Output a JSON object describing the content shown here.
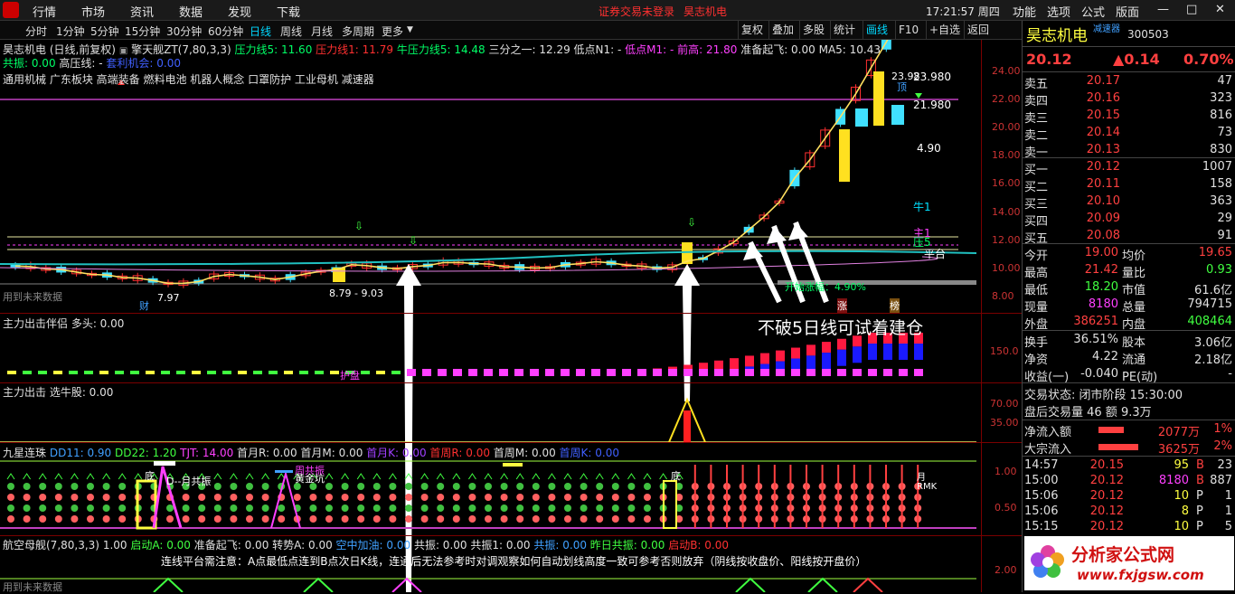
{
  "menu": [
    "行情",
    "市场",
    "资讯",
    "数据",
    "发现",
    "下载"
  ],
  "notice": [
    "证券交易未登录",
    "昊志机电"
  ],
  "clock": "17:21:57 周四",
  "right_menu": [
    "功能",
    "选项",
    "公式",
    "版面"
  ],
  "window_controls": [
    "—",
    "□",
    "✕"
  ],
  "periods": [
    "分时",
    "1分钟",
    "5分钟",
    "15分钟",
    "30分钟",
    "60分钟",
    "日线",
    "周线",
    "月线",
    "多周期",
    "更多"
  ],
  "active_period": "日线",
  "toolbar_right": [
    "复权",
    "叠加",
    "多股",
    "统计",
    "画线",
    "F10",
    "+自选",
    "返回"
  ],
  "chart": {
    "title": "昊志机电 (日线,前复权)",
    "indicator_name": "擎天舰ZT(7,80,3,3)",
    "line1": [
      {
        "t": "压力线5: 11.60",
        "c": "#00ff66"
      },
      {
        "t": "压力线1: 11.79",
        "c": "#ff3030"
      },
      {
        "t": "牛压力线5: 14.48",
        "c": "#00ff66"
      },
      {
        "t": "三分之一: 12.29",
        "c": "#e0e0e0"
      },
      {
        "t": "低点N1: -",
        "c": "#e0e0e0"
      },
      {
        "t": "低点M1: -",
        "c": "#ff40ff"
      },
      {
        "t": "前高: 21.80",
        "c": "#ff40ff"
      },
      {
        "t": "准备起飞: 0.00",
        "c": "#e0e0e0"
      },
      {
        "t": "MA5: 10.43",
        "c": "#e0e0e0"
      }
    ],
    "line2": [
      {
        "t": "共振: 0.00",
        "c": "#00ff66"
      },
      {
        "t": "高压线: -",
        "c": "#e0e0e0"
      },
      {
        "t": "套利机会: 0.00",
        "c": "#4060ff"
      }
    ],
    "sectors": "通用机械 广东板块 高端装备 燃料电池 机器人概念 口罩防护 工业母机 减速器",
    "yaxis": [
      "24.00",
      "22.00",
      "20.00",
      "18.00",
      "16.00",
      "14.00",
      "12.00",
      "10.00",
      "8.00"
    ],
    "annotations": {
      "high_label": "23.98",
      "high_right": "23.980",
      "price2": "21.980",
      "low_label": "7.97",
      "range_label": "8.79 - 9.03",
      "niu1": "牛1",
      "zhu1": "主1",
      "ya5": "压5",
      "pingtai": "平台",
      "price_mark": "4.90",
      "cai": "财",
      "zhang": "涨",
      "bang": "榜",
      "ding": "顶",
      "kaishi": "开始涨幅：4.90%",
      "future_data": "用到未来数据",
      "callout": "不破5日线可试着建仓"
    }
  },
  "panel1": {
    "title": "主力出击伴侣 多头: 0.00",
    "yaxis": [
      "150.0"
    ],
    "label": "护盘"
  },
  "panel2": {
    "title": "主力出击 选牛股: 0.00",
    "yaxis": [
      "70.00",
      "35.00"
    ]
  },
  "panel3": {
    "title": "九星连珠",
    "items": [
      {
        "t": "DD11: 0.90",
        "c": "#40a0ff"
      },
      {
        "t": "DD22: 1.20",
        "c": "#40ff40"
      },
      {
        "t": "TJT: 14.00",
        "c": "#ff40ff"
      },
      {
        "t": "首月R: 0.00",
        "c": "#e0e0e0"
      },
      {
        "t": "首月M: 0.00",
        "c": "#e0e0e0"
      },
      {
        "t": "首月K: 0.00",
        "c": "#a040ff"
      },
      {
        "t": "首周R: 0.00",
        "c": "#ff3030"
      },
      {
        "t": "首周M: 0.00",
        "c": "#e0e0e0"
      },
      {
        "t": "首周K: 0.00",
        "c": "#4060ff"
      }
    ],
    "yaxis": [
      "1.00",
      "0.50"
    ],
    "labels": {
      "di": "底",
      "month": "D--月共振",
      "gold": "黄金坑",
      "week": "周共振",
      "right_di": "底",
      "rm": "月RMK"
    }
  },
  "panel4": {
    "title": "航空母舰(7,80,3,3)",
    "items": [
      {
        "t": "1.00",
        "c": "#e0e0e0"
      },
      {
        "t": "启动A: 0.00",
        "c": "#40ff40"
      },
      {
        "t": "准备起飞: 0.00",
        "c": "#e0e0e0"
      },
      {
        "t": "转势A: 0.00",
        "c": "#e0e0e0"
      },
      {
        "t": "空中加油: 0.00",
        "c": "#40a0ff"
      },
      {
        "t": "共振: 0.00",
        "c": "#e0e0e0"
      },
      {
        "t": "共振1: 0.00",
        "c": "#e0e0e0"
      },
      {
        "t": "共振: 0.00",
        "c": "#40a0ff"
      },
      {
        "t": "昨日共振: 0.00",
        "c": "#40ff40"
      },
      {
        "t": "启动B: 0.00",
        "c": "#ff3030"
      }
    ],
    "note": "连线平台需注意：A点最低点连到B点次日K线，连通后无法参考时对调观察如何自动划线高度一致可参考否则放弃（阴线按收盘价、阳线按开盘价）",
    "yaxis": [
      "2.00"
    ],
    "future_data": "用到未来数据"
  },
  "quote": {
    "name": "昊志机电",
    "tag": "减速器",
    "code": "300503",
    "price": "20.12",
    "change": "▲0.14",
    "pct": "0.70%",
    "asks": [
      {
        "l": "卖五",
        "p": "20.17",
        "v": "47"
      },
      {
        "l": "卖四",
        "p": "20.16",
        "v": "323"
      },
      {
        "l": "卖三",
        "p": "20.15",
        "v": "816"
      },
      {
        "l": "卖二",
        "p": "20.14",
        "v": "73"
      },
      {
        "l": "卖一",
        "p": "20.13",
        "v": "830"
      }
    ],
    "bids": [
      {
        "l": "买一",
        "p": "20.12",
        "v": "1007"
      },
      {
        "l": "买二",
        "p": "20.11",
        "v": "158"
      },
      {
        "l": "买三",
        "p": "20.10",
        "v": "363"
      },
      {
        "l": "买四",
        "p": "20.09",
        "v": "29"
      },
      {
        "l": "买五",
        "p": "20.08",
        "v": "91"
      }
    ],
    "stats": [
      {
        "l": "今开",
        "v": "19.00",
        "vc": "#ff4040",
        "l2": "均价",
        "v2": "19.65",
        "v2c": "#ff4040"
      },
      {
        "l": "最高",
        "v": "21.42",
        "vc": "#ff4040",
        "l2": "量比",
        "v2": "0.93",
        "v2c": "#40ff40"
      },
      {
        "l": "最低",
        "v": "18.20",
        "vc": "#40ff40",
        "l2": "市值",
        "v2": "61.6亿",
        "v2c": "#e0e0e0"
      },
      {
        "l": "现量",
        "v": "8180",
        "vc": "#ff40ff",
        "l2": "总量",
        "v2": "794715",
        "v2c": "#e0e0e0"
      },
      {
        "l": "外盘",
        "v": "386251",
        "vc": "#ff4040",
        "l2": "内盘",
        "v2": "408464",
        "v2c": "#40ff40"
      }
    ],
    "stats2": [
      {
        "l": "换手",
        "v": "36.51%",
        "vc": "#e0e0e0",
        "l2": "股本",
        "v2": "3.06亿",
        "v2c": "#e0e0e0"
      },
      {
        "l": "净资",
        "v": "4.22",
        "vc": "#e0e0e0",
        "l2": "流通",
        "v2": "2.18亿",
        "v2c": "#e0e0e0"
      },
      {
        "l": "收益(一)",
        "v": "-0.040",
        "vc": "#e0e0e0",
        "l2": "PE(动)",
        "v2": "-",
        "v2c": "#e0e0e0"
      }
    ],
    "trade_status": "交易状态: 闭市阶段 15:30:00",
    "after_hours": "盘后交易量 46 额 9.3万",
    "flows": [
      {
        "l": "净流入额",
        "v": "2077万",
        "p": "1%"
      },
      {
        "l": "大宗流入",
        "v": "3625万",
        "p": "2%"
      }
    ],
    "ticks": [
      {
        "t": "14:57",
        "p": "20.15",
        "v": "95",
        "f": "B",
        "n": "23"
      },
      {
        "t": "15:00",
        "p": "20.12",
        "v": "8180",
        "f": "B",
        "n": "887"
      },
      {
        "t": "15:06",
        "p": "20.12",
        "v": "10",
        "f": "P",
        "n": "1"
      },
      {
        "t": "15:06",
        "p": "20.12",
        "v": "8",
        "f": "P",
        "n": "1"
      },
      {
        "t": "15:15",
        "p": "20.12",
        "v": "10",
        "f": "P",
        "n": "5"
      }
    ]
  },
  "watermark": {
    "name": "分析家公式网",
    "url": "www.fxjgsw.com"
  }
}
